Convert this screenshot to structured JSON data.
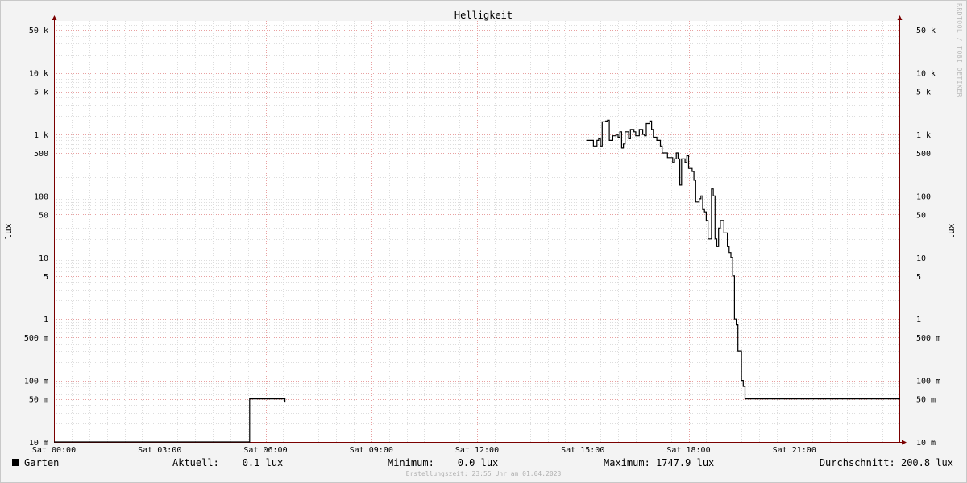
{
  "chart_data": {
    "type": "line",
    "title": "Helligkeit",
    "ylabel": "lux",
    "yscale": "log",
    "ylim": [
      0.01,
      70000
    ],
    "xlim": [
      0,
      24
    ],
    "yticks": [
      {
        "v": 50000,
        "label": "50 k"
      },
      {
        "v": 10000,
        "label": "10 k"
      },
      {
        "v": 5000,
        "label": "5 k"
      },
      {
        "v": 1000,
        "label": "1 k"
      },
      {
        "v": 500,
        "label": "500"
      },
      {
        "v": 100,
        "label": "100"
      },
      {
        "v": 50,
        "label": "50"
      },
      {
        "v": 10,
        "label": "10"
      },
      {
        "v": 5,
        "label": "5"
      },
      {
        "v": 1,
        "label": "1"
      },
      {
        "v": 0.5,
        "label": "500 m"
      },
      {
        "v": 0.1,
        "label": "100 m"
      },
      {
        "v": 0.05,
        "label": "50 m"
      },
      {
        "v": 0.01,
        "label": "10 m"
      }
    ],
    "xticks": [
      {
        "v": 0,
        "label": "Sat 00:00"
      },
      {
        "v": 3,
        "label": "Sat 03:00"
      },
      {
        "v": 6,
        "label": "Sat 06:00"
      },
      {
        "v": 9,
        "label": "Sat 09:00"
      },
      {
        "v": 12,
        "label": "Sat 12:00"
      },
      {
        "v": 15,
        "label": "Sat 15:00"
      },
      {
        "v": 18,
        "label": "Sat 18:00"
      },
      {
        "v": 21,
        "label": "Sat 21:00"
      }
    ],
    "grid": true,
    "series": [
      {
        "name": "Garten",
        "color": "#000000",
        "segments": [
          [
            [
              0,
              0.01
            ],
            [
              5.55,
              0.01
            ],
            [
              5.55,
              0.05
            ],
            [
              6.5,
              0.05
            ],
            [
              6.55,
              0.045
            ]
          ],
          [
            [
              15.1,
              800
            ],
            [
              15.25,
              800
            ],
            [
              15.3,
              650
            ],
            [
              15.4,
              800
            ],
            [
              15.45,
              850
            ],
            [
              15.5,
              650
            ],
            [
              15.55,
              1600
            ],
            [
              15.65,
              1650
            ],
            [
              15.7,
              1700
            ],
            [
              15.75,
              800
            ],
            [
              15.85,
              950
            ],
            [
              15.9,
              950
            ],
            [
              15.95,
              1000
            ],
            [
              16.0,
              900
            ],
            [
              16.05,
              1100
            ],
            [
              16.1,
              600
            ],
            [
              16.15,
              700
            ],
            [
              16.2,
              1100
            ],
            [
              16.3,
              850
            ],
            [
              16.35,
              1200
            ],
            [
              16.45,
              1100
            ],
            [
              16.5,
              950
            ],
            [
              16.6,
              1200
            ],
            [
              16.7,
              1000
            ],
            [
              16.75,
              950
            ],
            [
              16.8,
              1500
            ],
            [
              16.9,
              1650
            ],
            [
              16.95,
              1200
            ],
            [
              17.0,
              900
            ],
            [
              17.1,
              800
            ],
            [
              17.2,
              650
            ],
            [
              17.25,
              500
            ],
            [
              17.35,
              500
            ],
            [
              17.4,
              420
            ],
            [
              17.5,
              420
            ],
            [
              17.55,
              350
            ],
            [
              17.6,
              400
            ],
            [
              17.65,
              500
            ],
            [
              17.7,
              400
            ],
            [
              17.75,
              150
            ],
            [
              17.8,
              400
            ],
            [
              17.9,
              350
            ],
            [
              17.95,
              450
            ],
            [
              18.0,
              280
            ],
            [
              18.1,
              250
            ],
            [
              18.15,
              180
            ],
            [
              18.2,
              80
            ],
            [
              18.3,
              90
            ],
            [
              18.35,
              100
            ],
            [
              18.4,
              60
            ],
            [
              18.45,
              55
            ],
            [
              18.5,
              40
            ],
            [
              18.55,
              20
            ],
            [
              18.6,
              20
            ],
            [
              18.65,
              130
            ],
            [
              18.7,
              100
            ],
            [
              18.75,
              20
            ],
            [
              18.8,
              15
            ],
            [
              18.85,
              30
            ],
            [
              18.9,
              40
            ],
            [
              18.95,
              40
            ],
            [
              19.0,
              25
            ],
            [
              19.1,
              15
            ],
            [
              19.15,
              12
            ],
            [
              19.2,
              10
            ],
            [
              19.25,
              5
            ],
            [
              19.3,
              1
            ],
            [
              19.35,
              0.8
            ],
            [
              19.4,
              0.3
            ],
            [
              19.45,
              0.3
            ],
            [
              19.5,
              0.1
            ],
            [
              19.55,
              0.08
            ],
            [
              19.6,
              0.05
            ],
            [
              24.0,
              0.05
            ]
          ]
        ]
      }
    ]
  },
  "legend": {
    "name": "Garten",
    "color": "#000000"
  },
  "stats": {
    "current": "Aktuell:    0.1 lux",
    "min": "Minimum:    0.0 lux",
    "max": "Maximum: 1747.9 lux",
    "avg": "Durchschnitt: 200.8 lux"
  },
  "timestamp": "Erstellungszeit: 23:55 Uhr am 01.04.2023",
  "watermark": "RRDTOOL / TOBI OETIKER",
  "colors": {
    "background": "#f3f3f3",
    "canvas": "#ffffff",
    "minor_grid": "#dddddd",
    "major_grid": "#e8a0a0",
    "axis": "#7a0000",
    "line": "#000000"
  }
}
